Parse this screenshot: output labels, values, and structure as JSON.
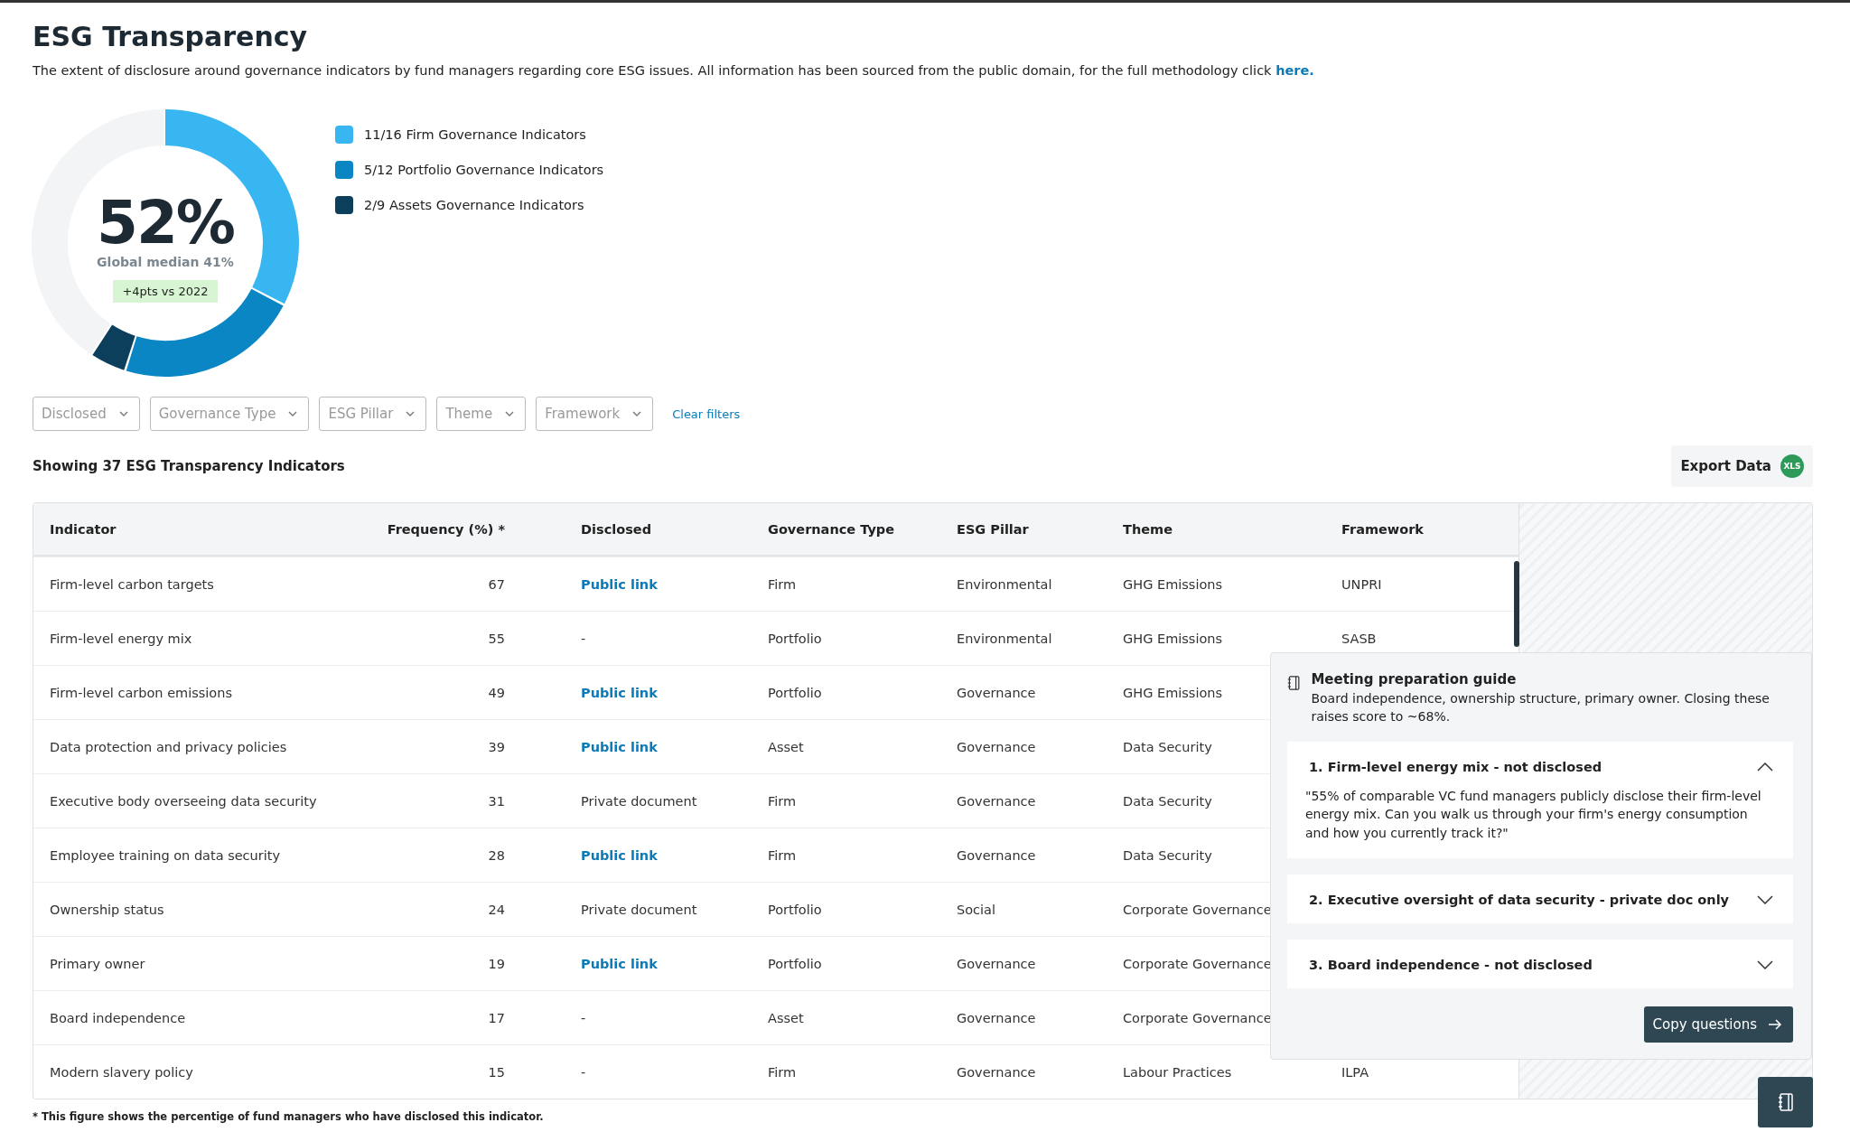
{
  "header": {
    "title": "ESG Transparency",
    "description": "The extent of disclosure around governance indicators by fund managers regarding core ESG issues. All information has been sourced from the public domain, for the full methodology click ",
    "link": "here."
  },
  "score": {
    "value": "52%",
    "median": "Global median 41%",
    "change": "+4pts vs 2022"
  },
  "legend": [
    {
      "label": "11/16 Firm  Governance Indicators",
      "color": "#38b6f2"
    },
    {
      "label": "5/12 Portfolio Governance Indicators",
      "color": "#0a86c4"
    },
    {
      "label": "2/9 Assets Governance Indicators",
      "color": "#0b3f5c"
    }
  ],
  "filters": [
    {
      "placeholder": "Disclosed"
    },
    {
      "placeholder": "Governance Type"
    },
    {
      "placeholder": "ESG Pillar"
    },
    {
      "placeholder": "Theme"
    },
    {
      "placeholder": "Framework"
    }
  ],
  "clear_filters": "Clear filters",
  "summary": "Showing 37 ESG Transparency Indicators",
  "export": {
    "label": "Export Data",
    "badge": "XLS"
  },
  "table": {
    "columns": [
      "Indicator",
      "Frequency (%) *",
      "Disclosed",
      "Governance Type",
      "ESG Pillar",
      "Theme",
      "Framework"
    ],
    "rows": [
      {
        "indicator": "Firm-level carbon targets",
        "frequency": "67",
        "disclosed": {
          "text": "Public link",
          "kind": "link"
        },
        "governance_type": "Firm",
        "pillar": "Environmental",
        "theme": "GHG Emissions",
        "framework": "UNPRI"
      },
      {
        "indicator": "Firm-level energy mix",
        "frequency": "55",
        "disclosed": {
          "text": "-",
          "kind": "plain"
        },
        "governance_type": "Portfolio",
        "pillar": "Environmental",
        "theme": "GHG Emissions",
        "framework": "SASB"
      },
      {
        "indicator": "Firm-level carbon emissions",
        "frequency": "49",
        "disclosed": {
          "text": "Public link",
          "kind": "link"
        },
        "governance_type": "Portfolio",
        "pillar": "Governance",
        "theme": "GHG Emissions"
      },
      {
        "indicator": "Data protection and privacy policies",
        "frequency": "39",
        "disclosed": {
          "text": "Public link",
          "kind": "link"
        },
        "governance_type": "Asset",
        "pillar": "Governance",
        "theme": "Data Security"
      },
      {
        "indicator": "Executive body overseeing data security",
        "frequency": "31",
        "disclosed": {
          "text": "Private document",
          "kind": "plain"
        },
        "governance_type": "Firm",
        "pillar": "Governance",
        "theme": "Data Security"
      },
      {
        "indicator": "Employee training on data security",
        "frequency": "28",
        "disclosed": {
          "text": "Public link",
          "kind": "link"
        },
        "governance_type": "Firm",
        "pillar": "Governance",
        "theme": "Data Security"
      },
      {
        "indicator": "Ownership status",
        "frequency": "24",
        "disclosed": {
          "text": "Private document",
          "kind": "plain"
        },
        "governance_type": "Portfolio",
        "pillar": "Social",
        "theme": "Corporate Governance"
      },
      {
        "indicator": "Primary owner",
        "frequency": "19",
        "disclosed": {
          "text": "Public link",
          "kind": "link"
        },
        "governance_type": "Portfolio",
        "pillar": "Governance",
        "theme": "Corporate Governance"
      },
      {
        "indicator": "Board independence",
        "frequency": "17",
        "disclosed": {
          "text": "-",
          "kind": "plain"
        },
        "governance_type": "Asset",
        "pillar": "Governance",
        "theme": "Corporate Governance"
      },
      {
        "indicator": "Modern slavery policy",
        "frequency": "15",
        "disclosed": {
          "text": "-",
          "kind": "plain"
        },
        "governance_type": "Firm",
        "pillar": "Governance",
        "theme": "Labour Practices",
        "framework": "ILPA"
      }
    ]
  },
  "footnote": "* This figure shows the percentige of fund managers who have disclosed this indicator.",
  "guide": {
    "title": "Meeting preparation guide",
    "summary": "Board independence, ownership structure, primary owner. Closing these raises score to ~68%.",
    "items": [
      {
        "title": "1. Firm-level energy mix - not disclosed",
        "expanded": true,
        "body": "\"55% of comparable VC fund managers publicly disclose their firm-level energy mix. Can you walk us through your firm's energy consumption and how you currently track it?\""
      },
      {
        "title": "2. Executive oversight of data security - private doc only",
        "expanded": false
      },
      {
        "title": "3. Board independence - not disclosed",
        "expanded": false
      }
    ],
    "button": "Copy questions"
  }
}
